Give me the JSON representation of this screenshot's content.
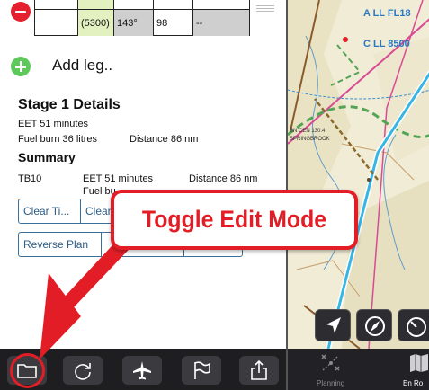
{
  "leg_row": {
    "altitude": "(5300)",
    "track": "143°",
    "speed": "98",
    "time": "--"
  },
  "add_leg_label": "Add leg..",
  "stage": {
    "title": "Stage 1 Details",
    "eet": "EET 51 minutes",
    "fuel": "Fuel burn 36 litres",
    "distance": "Distance 86 nm"
  },
  "summary": {
    "title": "Summary",
    "aircraft": "TB10",
    "eet": "EET 51 minutes",
    "distance": "Distance 86 nm",
    "fuel_partial": "Fuel bu"
  },
  "buttons": {
    "clear_times": "Clear Ti...",
    "clear_other": "Clear",
    "reverse_plan": "Reverse Plan"
  },
  "annotation": {
    "text": "Toggle Edit Mode"
  },
  "map_labels": {
    "airspace_a": "A  LL  FL18",
    "airspace_c": "C  LL  8500",
    "cen": "BN CEN 130.4",
    "place": "SPRINGBROOK"
  },
  "bottom_bar": {
    "planning_label": "Planning",
    "enroute_label": "En Ro"
  },
  "icons": {
    "toolbar": [
      "folder-icon",
      "refresh-icon",
      "airplane-icon",
      "flag-icon",
      "share-icon"
    ],
    "map": [
      "locate-arrow-icon",
      "compass-icon",
      "gauge-icon"
    ]
  },
  "colors": {
    "accent_red": "#e31d26",
    "remove_red": "#e5202e",
    "add_green": "#5cc95a",
    "button_blue": "#2b5d87",
    "toolbar_dark": "#1e1e21"
  }
}
